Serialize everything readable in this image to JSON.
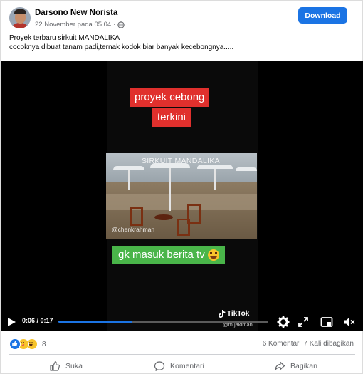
{
  "post": {
    "author": "Darsono New Norista",
    "timestamp": "22 November pada 05.04",
    "privacy_icon": "globe-icon",
    "download_label": "Download",
    "caption_line1": "Proyek terbaru sirkuit MANDALIKA",
    "caption_line2": "cocoknya dibuat tanam padi,ternak kodok biar banyak kecebongnya....."
  },
  "video": {
    "overlay_top_line1": "proyek cebong",
    "overlay_top_line2": "terkini",
    "clip_title": "SIRKUIT MANDALIKA",
    "clip_handle": "@chenkrahman",
    "overlay_bottom": "gk masuk berita tv",
    "tiktok_brand": "TikTok",
    "tiktok_handle": "@m.jakiman",
    "time_display": "0:06 / 0:17",
    "progress_fraction": 0.3529,
    "accent_color": "#1b74e4"
  },
  "engagement": {
    "reaction_count": "8",
    "comments": "6 Komentar",
    "shares": "7 Kali dibagikan"
  },
  "actions": {
    "like_label": "Suka",
    "comment_label": "Komentari",
    "share_label": "Bagikan"
  }
}
